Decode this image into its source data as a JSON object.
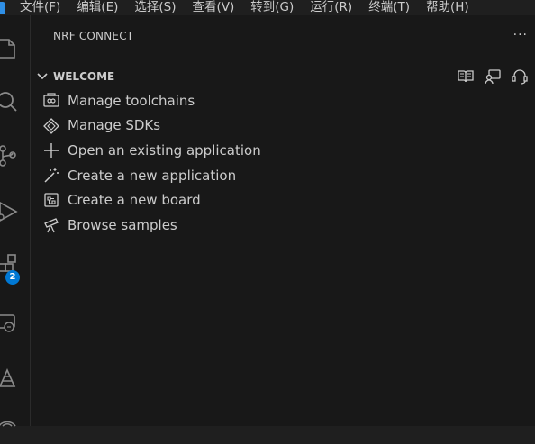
{
  "menubar": {
    "items": [
      "文件(F)",
      "编辑(E)",
      "选择(S)",
      "查看(V)",
      "转到(G)",
      "运行(R)",
      "终端(T)",
      "帮助(H)"
    ]
  },
  "activitybar": {
    "icons": [
      "explorer-icon",
      "search-icon",
      "source-control-icon",
      "run-debug-icon",
      "extensions-icon",
      "remote-explorer-icon",
      "nrf-connect-icon",
      "devicetree-icon"
    ],
    "extensions_badge": "2",
    "badge_color": "#0078d4"
  },
  "panel": {
    "title": "NRF CONNECT",
    "more": "···"
  },
  "welcome": {
    "title": "WELCOME",
    "actions": [
      "documentation-icon",
      "feedback-icon",
      "support-icon"
    ],
    "items": [
      {
        "label": "Manage toolchains",
        "icon": "toolchain-icon"
      },
      {
        "label": "Manage SDKs",
        "icon": "sdk-icon"
      },
      {
        "label": "Open an existing application",
        "icon": "plus-icon"
      },
      {
        "label": "Create a new application",
        "icon": "magic-wand-icon"
      },
      {
        "label": "Create a new board",
        "icon": "board-icon"
      },
      {
        "label": "Browse samples",
        "icon": "telescope-icon"
      }
    ]
  }
}
